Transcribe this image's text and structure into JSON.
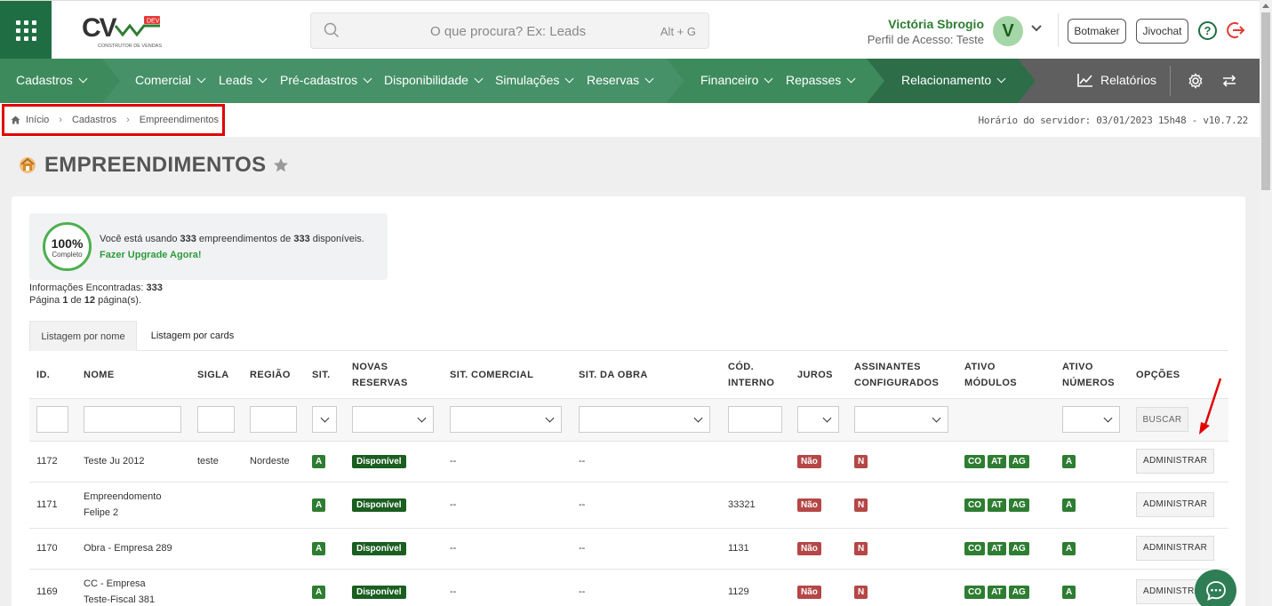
{
  "header": {
    "logo_text": "CV",
    "logo_tag": "DEV",
    "logo_sub": "CONSTRUTOR DE VENDAS",
    "search_placeholder": "O que procura? Ex: Leads",
    "search_shortcut": "Alt + G",
    "user_name": "Victória Sbrogio",
    "user_profile": "Perfil de Acesso: Teste",
    "avatar_letter": "V",
    "botmaker_label": "Botmaker",
    "jivochat_label": "Jivochat",
    "help_label": "?"
  },
  "nav": {
    "items": [
      "Cadastros",
      "Comercial",
      "Leads",
      "Pré-cadastros",
      "Disponibilidade",
      "Simulações",
      "Reservas",
      "Financeiro",
      "Repasses",
      "Relacionamento"
    ],
    "reports_label": "Relatórios",
    "colors": {
      "dark_green": "#3d8b5c",
      "mid_green": "#469168",
      "gray": "#5f5f5f"
    }
  },
  "breadcrumb": {
    "items": [
      "Início",
      "Cadastros",
      "Empreendimentos"
    ],
    "server_time": "Horário do servidor: 03/01/2023 15h48 - v10.7.22"
  },
  "page": {
    "title": "EMPREENDIMENTOS"
  },
  "usage": {
    "percent": "100%",
    "percent_label": "Completo",
    "text_a": "Você está usando ",
    "used": "333",
    "text_b": " empreendimentos de ",
    "total": "333",
    "text_c": " disponíveis.",
    "upgrade": "Fazer Upgrade Agora!"
  },
  "info": {
    "found_label": "Informações Encontradas: ",
    "found": "333",
    "page_a": "Página ",
    "page": "1",
    "page_b": " de ",
    "pages": "12",
    "page_c": " página(s)."
  },
  "tabs": [
    "Listagem por nome",
    "Listagem por cards"
  ],
  "table": {
    "headers": {
      "id": "ID.",
      "nome": "NOME",
      "sigla": "SIGLA",
      "regiao": "REGIÃO",
      "sit": "SIT.",
      "novas_a": "NOVAS",
      "novas_b": "RESERVAS",
      "sit_comercial": "SIT. COMERCIAL",
      "sit_obra": "SIT. DA OBRA",
      "cod_a": "CÓD.",
      "cod_b": "INTERNO",
      "juros": "JUROS",
      "assin_a": "ASSINANTES",
      "assin_b": "CONFIGURADOS",
      "mod_a": "ATIVO",
      "mod_b": "MÓDULOS",
      "num_a": "ATIVO",
      "num_b": "NÚMEROS",
      "opcoes": "OPÇÕES"
    },
    "search_button": "BUSCAR",
    "rows": [
      {
        "id": "1172",
        "nome": "Teste Ju 2012",
        "sigla": "teste",
        "regiao": "Nordeste",
        "sit": "A",
        "novas": "Disponível",
        "sit_comercial": "--",
        "sit_obra": "--",
        "cod": "",
        "juros": "Não",
        "assin": "N",
        "mod1": "CO",
        "mod2": "AT",
        "mod3": "AG",
        "num": "A",
        "action": "ADMINISTRAR"
      },
      {
        "id": "1171",
        "nome": "Empreendomento Felipe 2",
        "sigla": "",
        "regiao": "",
        "sit": "A",
        "novas": "Disponível",
        "sit_comercial": "--",
        "sit_obra": "--",
        "cod": "33321",
        "juros": "Não",
        "assin": "N",
        "mod1": "CO",
        "mod2": "AT",
        "mod3": "AG",
        "num": "A",
        "action": "ADMINISTRAR"
      },
      {
        "id": "1170",
        "nome": "Obra - Empresa 289",
        "sigla": "",
        "regiao": "",
        "sit": "A",
        "novas": "Disponível",
        "sit_comercial": "--",
        "sit_obra": "--",
        "cod": "1131",
        "juros": "Não",
        "assin": "N",
        "mod1": "CO",
        "mod2": "AT",
        "mod3": "AG",
        "num": "A",
        "action": "ADMINISTRAR"
      },
      {
        "id": "1169",
        "nome": "CC - Empresa Teste-Fiscal 381",
        "sigla": "",
        "regiao": "",
        "sit": "A",
        "novas": "Disponível",
        "sit_comercial": "--",
        "sit_obra": "--",
        "cod": "1129",
        "juros": "Não",
        "assin": "N",
        "mod1": "CO",
        "mod2": "AT",
        "mod3": "AG",
        "num": "A",
        "action": "ADMINISTRAR"
      }
    ]
  }
}
